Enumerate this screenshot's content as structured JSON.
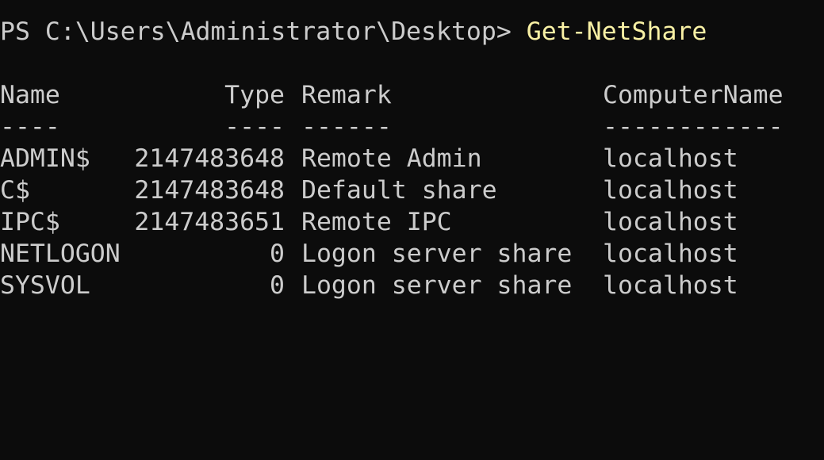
{
  "prompt": {
    "text": "PS C:\\Users\\Administrator\\Desktop> ",
    "command": "Get-NetShare"
  },
  "table": {
    "headers": {
      "name": "Name",
      "type": "Type",
      "remark": "Remark",
      "computer": "ComputerName"
    },
    "separators": {
      "name": "----",
      "type": "----",
      "remark": "------",
      "computer": "------------"
    },
    "rows": [
      {
        "name": "ADMIN$",
        "type": "2147483648",
        "remark": "Remote Admin",
        "computer": "localhost"
      },
      {
        "name": "C$",
        "type": "2147483648",
        "remark": "Default share",
        "computer": "localhost"
      },
      {
        "name": "IPC$",
        "type": "2147483651",
        "remark": "Remote IPC",
        "computer": "localhost"
      },
      {
        "name": "NETLOGON",
        "type": "0",
        "remark": "Logon server share",
        "computer": "localhost"
      },
      {
        "name": "SYSVOL",
        "type": "0",
        "remark": "Logon server share",
        "computer": "localhost"
      }
    ]
  },
  "colors": {
    "background": "#0c0c0c",
    "text": "#cccccc",
    "command": "#f9f1a5"
  }
}
